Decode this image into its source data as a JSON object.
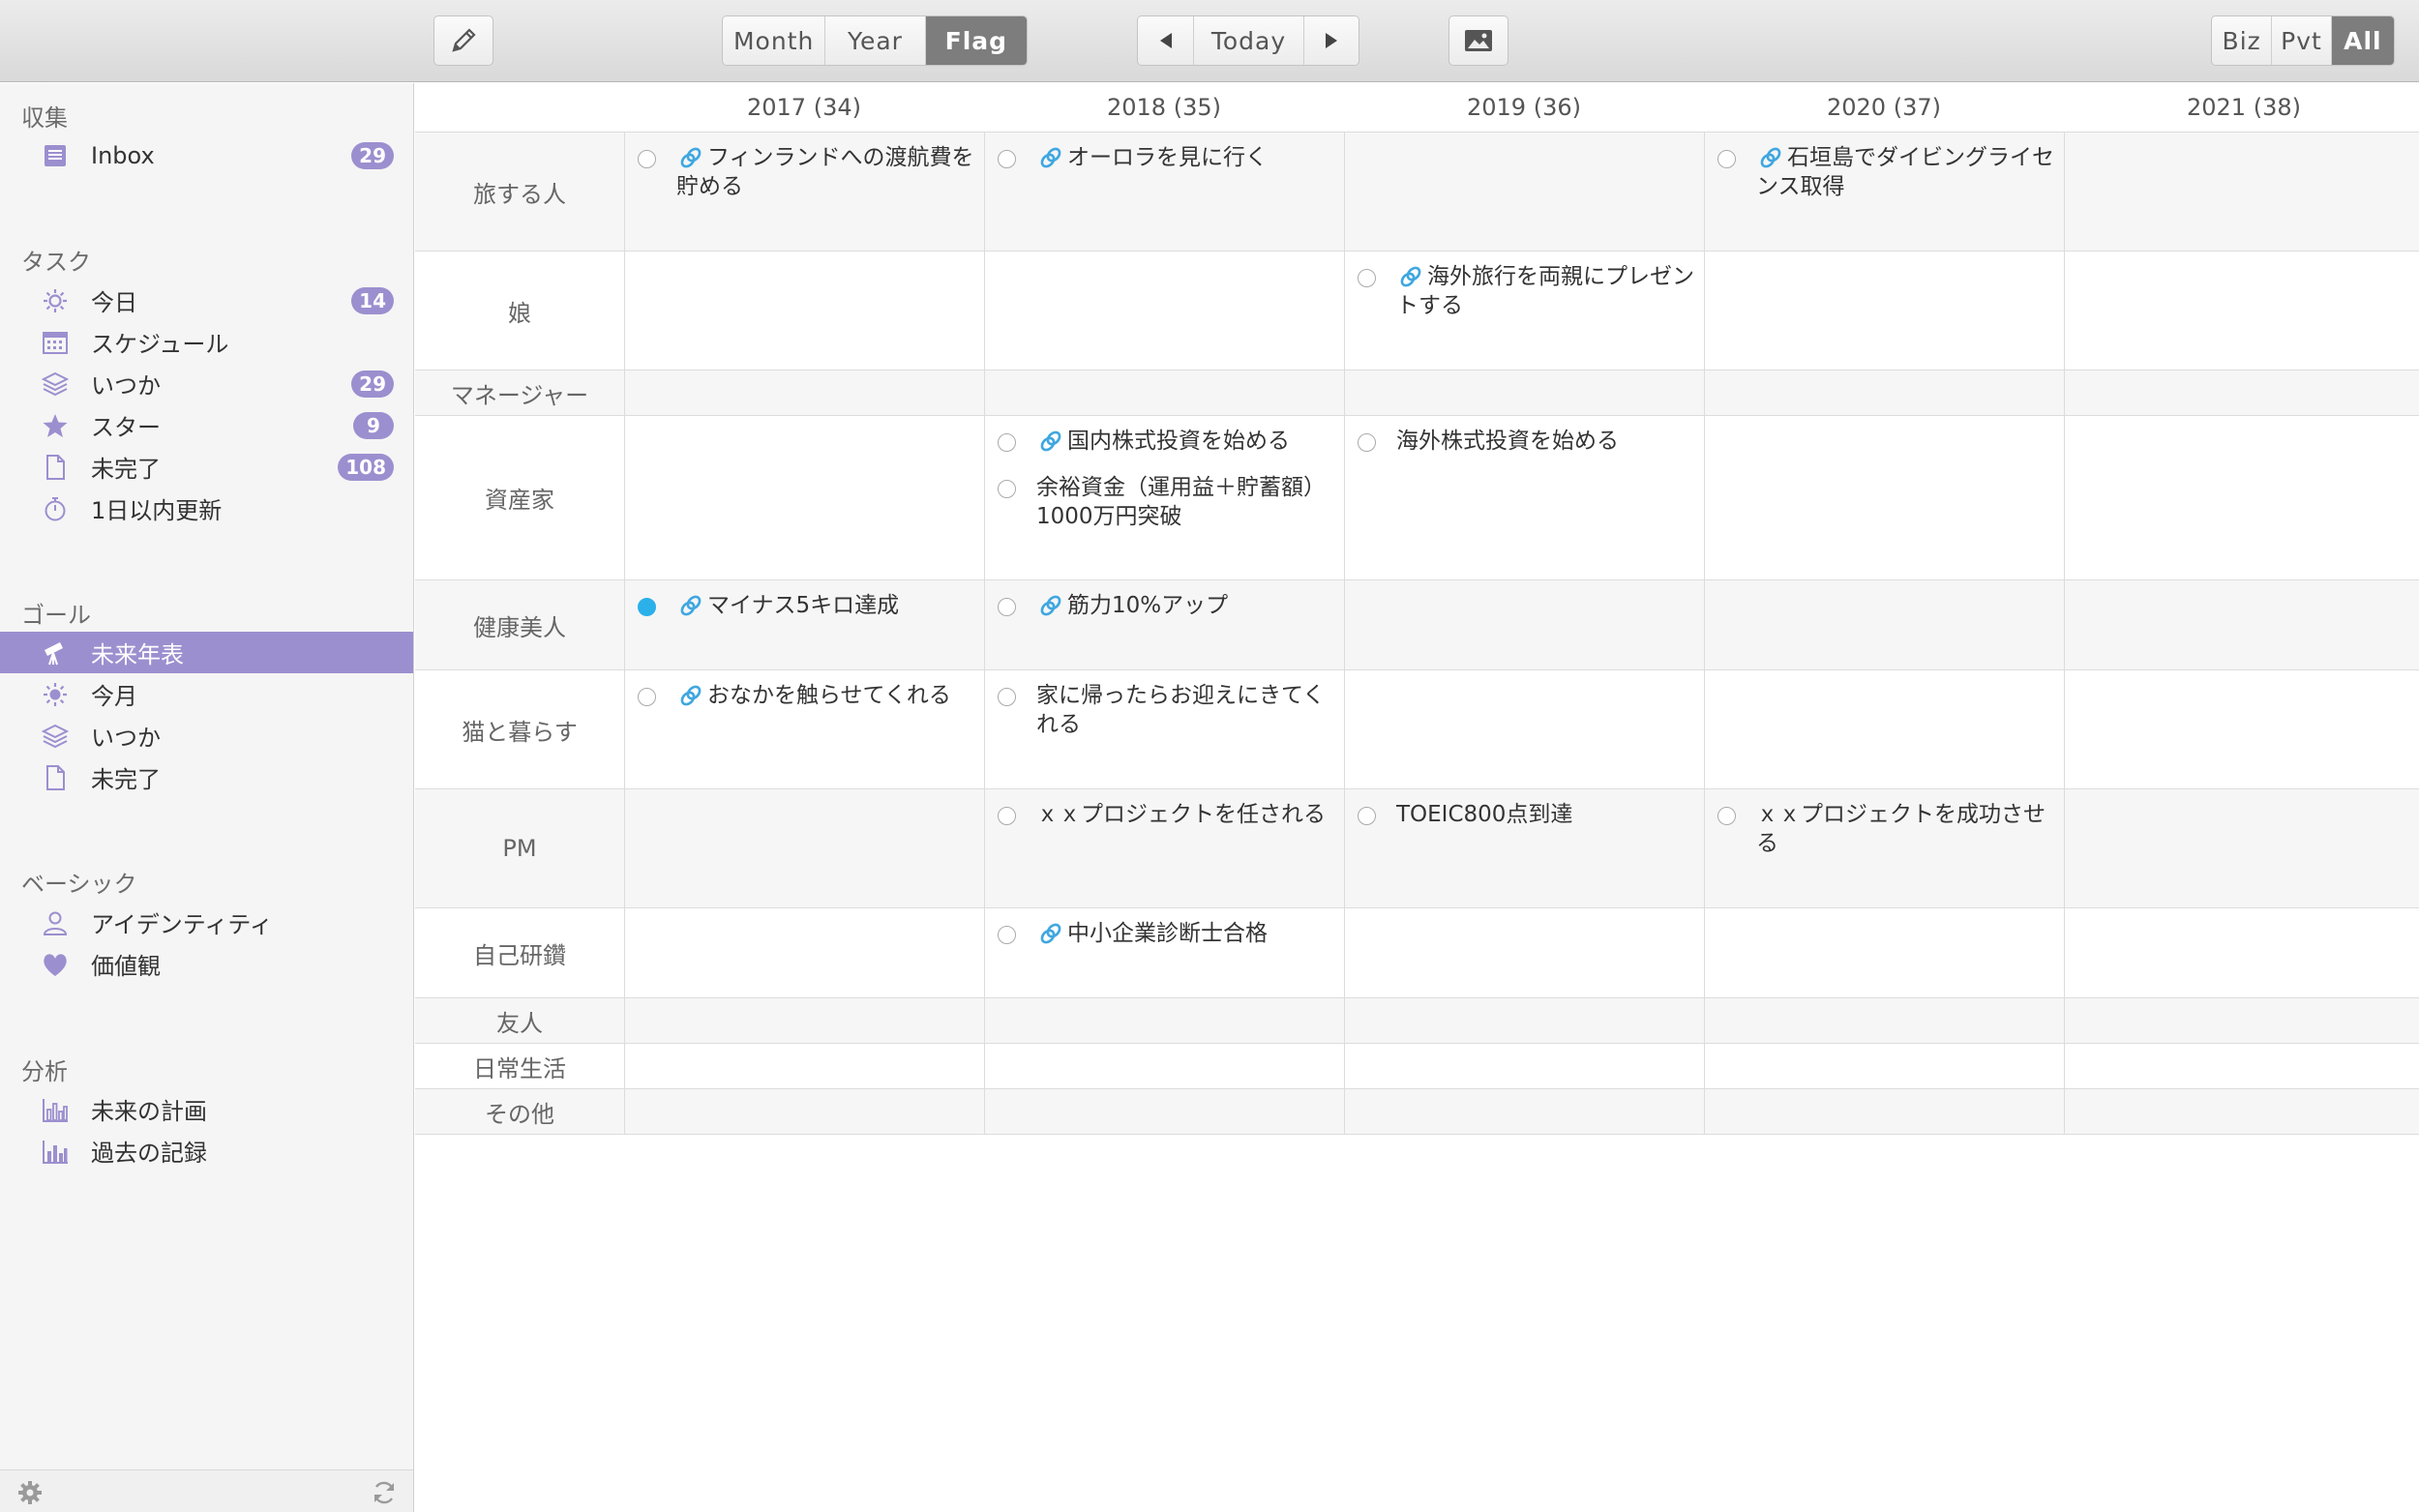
{
  "toolbar": {
    "view_tabs": [
      "Month",
      "Year",
      "Flag"
    ],
    "nav": {
      "today_label": "Today"
    },
    "filter_tabs": [
      "Biz",
      "Pvt",
      "All"
    ]
  },
  "sidebar": {
    "collect": {
      "title": "収集",
      "items": [
        {
          "label": "Inbox",
          "badge": "29",
          "icon": "inbox-icon"
        }
      ]
    },
    "tasks": {
      "title": "タスク",
      "items": [
        {
          "label": "今日",
          "badge": "14",
          "icon": "sun-icon"
        },
        {
          "label": "スケジュール",
          "badge": "",
          "icon": "calendar-icon"
        },
        {
          "label": "いつか",
          "badge": "29",
          "icon": "layers-icon"
        },
        {
          "label": "スター",
          "badge": "9",
          "icon": "star-icon"
        },
        {
          "label": "未完了",
          "badge": "108",
          "icon": "document-icon"
        },
        {
          "label": "1日以内更新",
          "badge": "",
          "icon": "stopwatch-icon"
        }
      ]
    },
    "goals": {
      "title": "ゴール",
      "items": [
        {
          "label": "未来年表",
          "icon": "telescope-icon",
          "selected": true
        },
        {
          "label": "今月",
          "icon": "sun-icon"
        },
        {
          "label": "いつか",
          "icon": "layers-icon"
        },
        {
          "label": "未完了",
          "icon": "document-icon"
        }
      ]
    },
    "basic": {
      "title": "ベーシック",
      "items": [
        {
          "label": "アイデンティティ",
          "icon": "person-icon"
        },
        {
          "label": "価値観",
          "icon": "heart-icon"
        }
      ]
    },
    "analysis": {
      "title": "分析",
      "items": [
        {
          "label": "未来の計画",
          "icon": "bar-chart-outline-icon"
        },
        {
          "label": "過去の記録",
          "icon": "bar-chart-icon"
        }
      ]
    }
  },
  "grid": {
    "years": [
      "2017 (34)",
      "2018 (35)",
      "2019 (36)",
      "2020 (37)",
      "2021 (38)"
    ],
    "rows": [
      "旅する人",
      "娘",
      "マネージャー",
      "資産家",
      "健康美人",
      "猫と暮らす",
      "PM",
      "自己研鑽",
      "友人",
      "日常生活",
      "その他"
    ],
    "tasks": [
      {
        "row": 0,
        "col": 0,
        "linked": true,
        "done": false,
        "text": "フィンランドへの渡航費を貯める"
      },
      {
        "row": 0,
        "col": 1,
        "linked": true,
        "done": false,
        "text": "オーロラを見に行く"
      },
      {
        "row": 0,
        "col": 3,
        "linked": true,
        "done": false,
        "text": "石垣島でダイビングライセンス取得"
      },
      {
        "row": 1,
        "col": 2,
        "linked": true,
        "done": false,
        "text": "海外旅行を両親にプレゼントする"
      },
      {
        "row": 3,
        "col": 1,
        "linked": true,
        "done": false,
        "text": "国内株式投資を始める"
      },
      {
        "row": 3,
        "col": 1,
        "linked": false,
        "done": false,
        "text": "余裕資金（運用益＋貯蓄額）1000万円突破"
      },
      {
        "row": 3,
        "col": 2,
        "linked": false,
        "done": false,
        "text": "海外株式投資を始める"
      },
      {
        "row": 4,
        "col": 0,
        "linked": true,
        "done": true,
        "text": "マイナス5キロ達成"
      },
      {
        "row": 4,
        "col": 1,
        "linked": true,
        "done": false,
        "text": "筋力10%アップ"
      },
      {
        "row": 5,
        "col": 0,
        "linked": true,
        "done": false,
        "text": "おなかを触らせてくれる"
      },
      {
        "row": 5,
        "col": 1,
        "linked": false,
        "done": false,
        "text": "家に帰ったらお迎えにきてくれる"
      },
      {
        "row": 6,
        "col": 1,
        "linked": false,
        "done": false,
        "text": "ｘｘプロジェクトを任される"
      },
      {
        "row": 6,
        "col": 2,
        "linked": false,
        "done": false,
        "text": "TOEIC800点到達"
      },
      {
        "row": 6,
        "col": 3,
        "linked": false,
        "done": false,
        "text": "ｘｘプロジェクトを成功させる"
      },
      {
        "row": 7,
        "col": 1,
        "linked": true,
        "done": false,
        "text": "中小企業診断士合格"
      }
    ]
  },
  "colors": {
    "accent": "#9c8fcf",
    "checked": "#2bb0ea",
    "link": "#3fa7e0"
  }
}
